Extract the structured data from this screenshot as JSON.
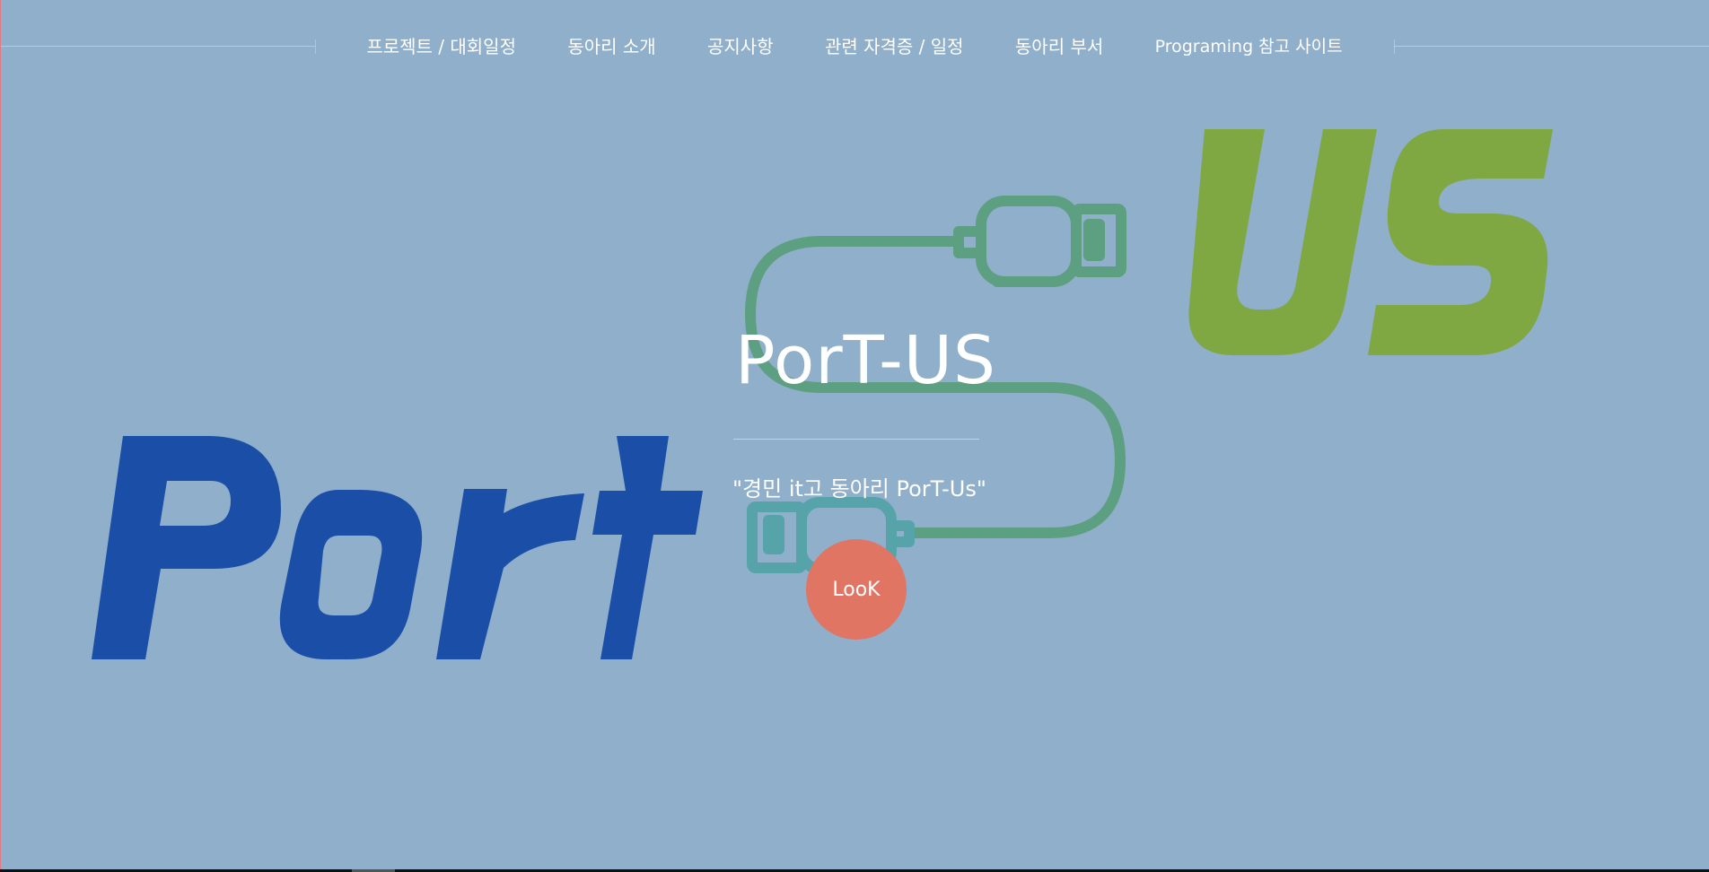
{
  "nav": {
    "items": [
      {
        "label": "프로젝트 / 대회일정"
      },
      {
        "label": "동아리 소개"
      },
      {
        "label": "공지사항"
      },
      {
        "label": "관련 자격증 / 일정"
      },
      {
        "label": "동아리 부서"
      },
      {
        "label": "Programing 참고 사이트"
      }
    ]
  },
  "hero": {
    "title": "PorT-US",
    "subtitle": "\"경민 it고 동아리 PorT-Us\"",
    "cta_label": "LooK"
  },
  "logo": {
    "left_text": "Port",
    "right_text": "US",
    "icon": "usb-cable-icon",
    "colors": {
      "port": "#1a4ea7",
      "us": "#7fa843",
      "cable_green": "#5d9f81",
      "cable_teal": "#56a3a9"
    }
  },
  "colors": {
    "background": "#8fafcb",
    "button": "#e07564",
    "text": "#ffffff"
  }
}
